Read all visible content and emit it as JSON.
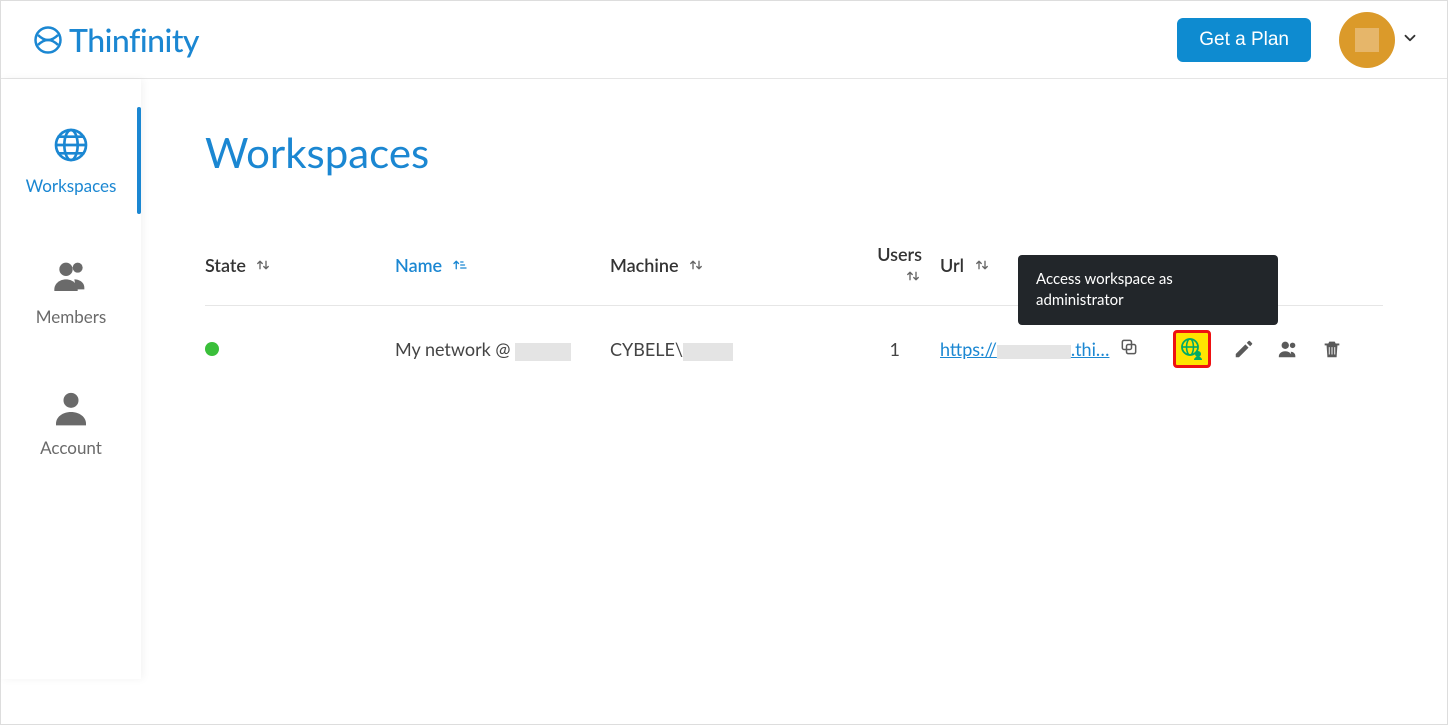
{
  "brand": "Thinfinity",
  "header": {
    "plan_button": "Get a Plan"
  },
  "sidebar": {
    "workspaces": "Workspaces",
    "members": "Members",
    "account": "Account"
  },
  "page": {
    "title": "Workspaces"
  },
  "columns": {
    "state": "State",
    "name": "Name",
    "machine": "Machine",
    "users": "Users",
    "url": "Url"
  },
  "row": {
    "name_prefix": "My network @ ",
    "machine_prefix": "CYBELE\\",
    "users": "1",
    "url_pre": "https://",
    "url_post": ".thi…"
  },
  "tooltip": "Access workspace as administrator"
}
